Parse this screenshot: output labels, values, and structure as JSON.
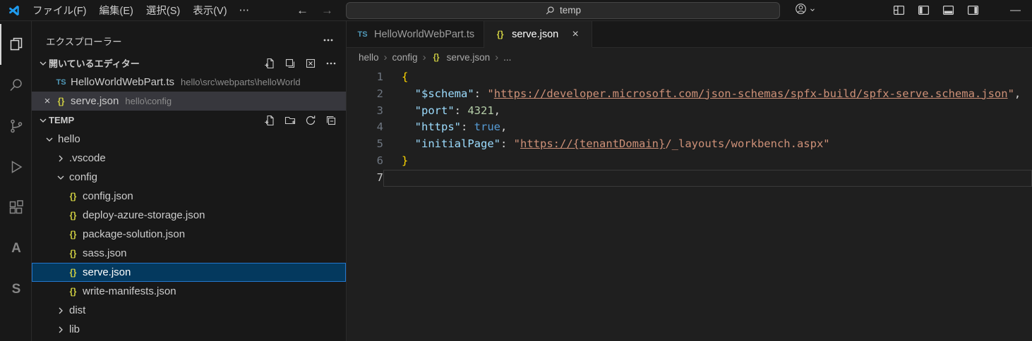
{
  "colors": {
    "accent": "#0078d4",
    "selection_background": "#04395e",
    "selection_border": "#2477ce",
    "json_icon": "#cbcb41",
    "ts_icon": "#519aba",
    "key": "#9cdcfe",
    "string": "#ce9178",
    "number": "#b5cea8",
    "keyword": "#569cd6",
    "bracket": "#ffd700"
  },
  "title_bar": {
    "menus": [
      "ファイル(F)",
      "編集(E)",
      "選択(S)",
      "表示(V)"
    ],
    "more_label": "⋯",
    "back_label": "←",
    "forward_label": "→",
    "search_value": "temp",
    "minimize_label": "—"
  },
  "activity_bar": {
    "items": [
      "explorer",
      "search",
      "source-control",
      "run-and-debug",
      "extensions",
      "azure",
      "spfx-toolkit"
    ],
    "active_item": "explorer",
    "azure_letter": "A",
    "spfx_letter": "S"
  },
  "sidebar": {
    "title": "エクスプローラー",
    "open_editors": {
      "label": "開いているエディター",
      "toolbar": [
        "new-untitled-file",
        "save-all",
        "close-all-editors",
        "more-actions"
      ],
      "items": [
        {
          "type": "ts",
          "name": "HelloWorldWebPart.ts",
          "path": "hello\\src\\webparts\\helloWorld",
          "active": false,
          "close": ""
        },
        {
          "type": "json",
          "name": "serve.json",
          "path": "hello\\config",
          "active": true,
          "close": "×"
        }
      ]
    },
    "workspace": {
      "label": "TEMP",
      "toolbar": [
        "new-file",
        "new-folder",
        "refresh-explorer",
        "collapse-folders"
      ],
      "items": [
        {
          "label": "hello",
          "indent": 1,
          "chevron": "down"
        },
        {
          "label": ".vscode",
          "indent": 2,
          "chevron": "right"
        },
        {
          "label": "config",
          "indent": 2,
          "chevron": "down"
        },
        {
          "label": "config.json",
          "indent": 3,
          "icon": "json"
        },
        {
          "label": "deploy-azure-storage.json",
          "indent": 3,
          "icon": "json"
        },
        {
          "label": "package-solution.json",
          "indent": 3,
          "icon": "json"
        },
        {
          "label": "sass.json",
          "indent": 3,
          "icon": "json"
        },
        {
          "label": "serve.json",
          "indent": 3,
          "icon": "json",
          "selected": true
        },
        {
          "label": "write-manifests.json",
          "indent": 3,
          "icon": "json"
        },
        {
          "label": "dist",
          "indent": 2,
          "chevron": "right"
        },
        {
          "label": "lib",
          "indent": 2,
          "chevron": "right"
        }
      ]
    }
  },
  "editor": {
    "tabs": [
      {
        "type": "ts",
        "label": "HelloWorldWebPart.ts",
        "active": false
      },
      {
        "type": "json",
        "label": "serve.json",
        "active": true,
        "close_label": "×"
      }
    ],
    "breadcrumb": {
      "items": [
        "hello",
        "config",
        "serve.json",
        "..."
      ],
      "separator": "›"
    },
    "code": {
      "lines": [
        {
          "n": "1",
          "tokens": [
            {
              "t": "{",
              "c": "bracket"
            }
          ]
        },
        {
          "n": "2",
          "tokens": [
            {
              "t": "  ",
              "c": "plain"
            },
            {
              "t": "\"$schema\"",
              "c": "key"
            },
            {
              "t": ": ",
              "c": "plain"
            },
            {
              "t": "\"",
              "c": "string"
            },
            {
              "t": "https://developer.microsoft.com/json-schemas/spfx-build/spfx-serve.schema.json",
              "c": "string",
              "u": true
            },
            {
              "t": "\"",
              "c": "string"
            },
            {
              "t": ",",
              "c": "plain"
            }
          ]
        },
        {
          "n": "3",
          "tokens": [
            {
              "t": "  ",
              "c": "plain"
            },
            {
              "t": "\"port\"",
              "c": "key"
            },
            {
              "t": ": ",
              "c": "plain"
            },
            {
              "t": "4321",
              "c": "number"
            },
            {
              "t": ",",
              "c": "plain"
            }
          ]
        },
        {
          "n": "4",
          "tokens": [
            {
              "t": "  ",
              "c": "plain"
            },
            {
              "t": "\"https\"",
              "c": "key"
            },
            {
              "t": ": ",
              "c": "plain"
            },
            {
              "t": "true",
              "c": "keyword"
            },
            {
              "t": ",",
              "c": "plain"
            }
          ]
        },
        {
          "n": "5",
          "tokens": [
            {
              "t": "  ",
              "c": "plain"
            },
            {
              "t": "\"initialPage\"",
              "c": "key"
            },
            {
              "t": ": ",
              "c": "plain"
            },
            {
              "t": "\"",
              "c": "string"
            },
            {
              "t": "https://{tenantDomain}",
              "c": "string",
              "u": true
            },
            {
              "t": "/_layouts/workbench.aspx",
              "c": "string"
            },
            {
              "t": "\"",
              "c": "string"
            }
          ]
        },
        {
          "n": "6",
          "tokens": [
            {
              "t": "}",
              "c": "bracket"
            }
          ]
        },
        {
          "n": "7",
          "current": true,
          "tokens": []
        }
      ]
    }
  }
}
